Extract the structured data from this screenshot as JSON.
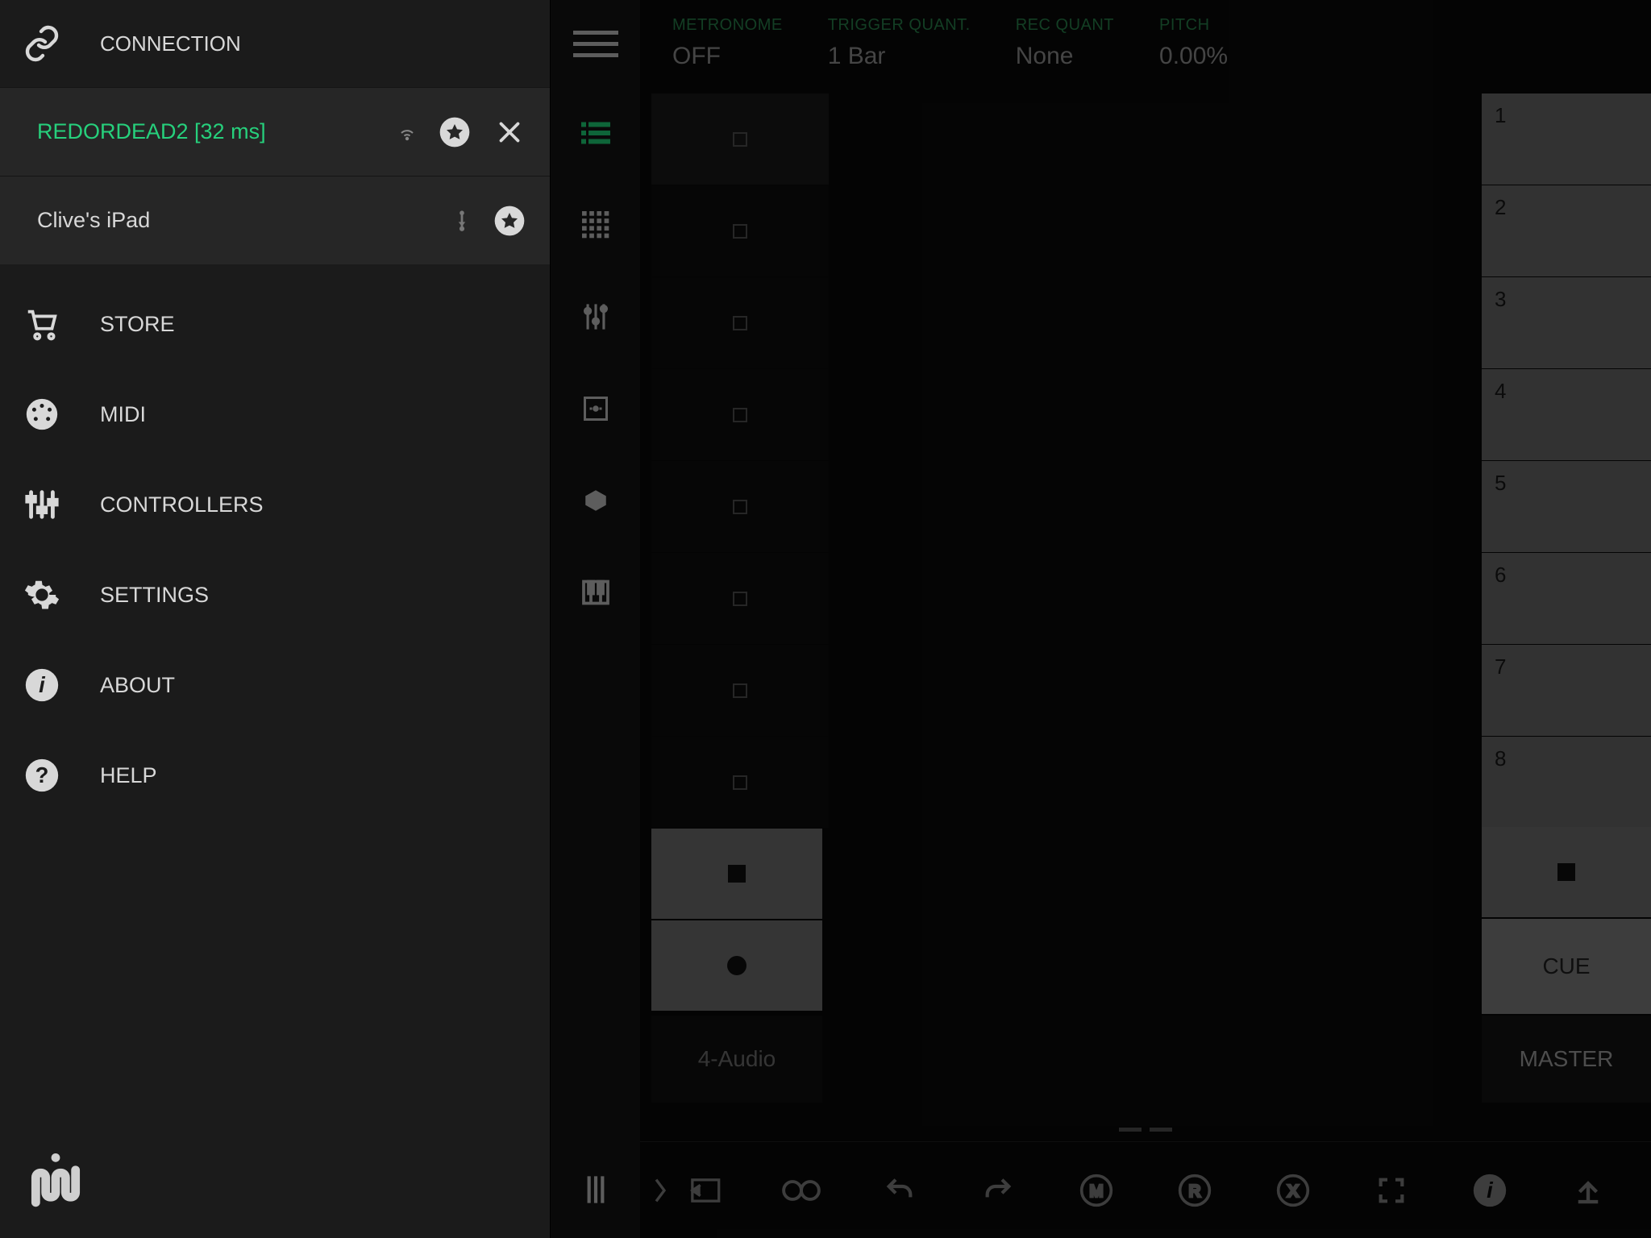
{
  "sidebar": {
    "header": {
      "label": "CONNECTION"
    },
    "connections": [
      {
        "name": "REDORDEAD2 [32 ms]",
        "signal": "wifi",
        "active": true,
        "starred": true,
        "closable": true
      },
      {
        "name": "Clive's iPad",
        "signal": "usb",
        "active": false,
        "starred": true,
        "closable": false
      }
    ],
    "menu": [
      {
        "id": "store",
        "label": "STORE"
      },
      {
        "id": "midi",
        "label": "MIDI"
      },
      {
        "id": "controllers",
        "label": "CONTROLLERS"
      },
      {
        "id": "settings",
        "label": "SETTINGS"
      },
      {
        "id": "about",
        "label": "ABOUT"
      },
      {
        "id": "help",
        "label": "HELP"
      }
    ]
  },
  "tool_strip": {
    "items": [
      {
        "id": "session-list",
        "active": true
      },
      {
        "id": "grid",
        "active": false
      },
      {
        "id": "mixer",
        "active": false
      },
      {
        "id": "device",
        "active": false
      },
      {
        "id": "drum",
        "active": false
      },
      {
        "id": "keys",
        "active": false
      }
    ]
  },
  "top_bar": {
    "metronome": {
      "label": "METRONOME",
      "value": "OFF"
    },
    "trigger": {
      "label": "TRIGGER QUANT.",
      "value": "1 Bar"
    },
    "rec": {
      "label": "REC QUANT",
      "value": "None"
    },
    "pitch": {
      "label": "PITCH",
      "value": "0.00%"
    }
  },
  "session": {
    "track_name": "4-Audio",
    "scenes": [
      "1",
      "2",
      "3",
      "4",
      "5",
      "6",
      "7",
      "8"
    ],
    "cue_label": "CUE",
    "master_label": "MASTER"
  },
  "colors": {
    "accent": "#1fe07f"
  }
}
